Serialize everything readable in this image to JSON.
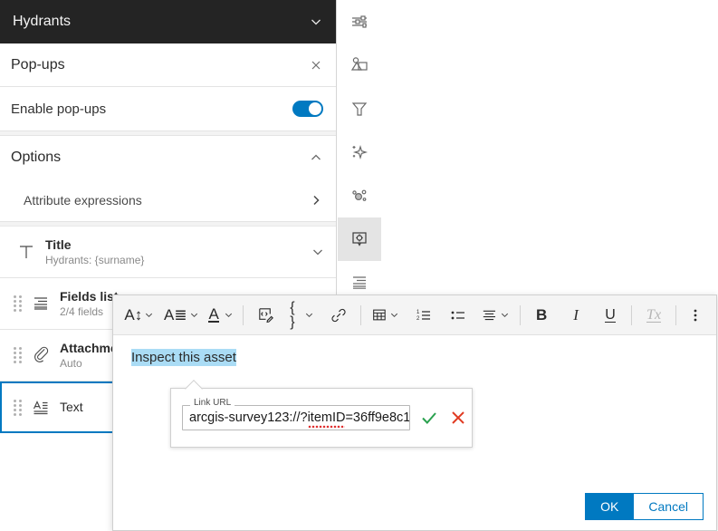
{
  "layer_panel": {
    "header": {
      "title": "Hydrants",
      "chevron_icon": "chevron-down-icon"
    },
    "popups": {
      "title": "Pop-ups",
      "close_icon": "close-icon"
    },
    "enable": {
      "label": "Enable pop-ups",
      "state": "on"
    },
    "options": {
      "label": "Options",
      "chevron_icon": "chevron-up-icon"
    },
    "attribute_expressions": {
      "label": "Attribute expressions",
      "chevron_icon": "chevron-right-icon"
    },
    "items": [
      {
        "name": "title-item",
        "icon": "text-title-icon",
        "title": "Title",
        "subtitle": "Hydrants: {surname}",
        "trailing_icon": "chevron-down-icon",
        "selected": false,
        "draggable": false
      },
      {
        "name": "fields-list-item",
        "icon": "fields-list-icon",
        "title": "Fields list",
        "subtitle": "2/4 fields",
        "selected": false,
        "draggable": true
      },
      {
        "name": "attachments-item",
        "icon": "paperclip-icon",
        "title": "Attachments",
        "subtitle": "Auto",
        "selected": false,
        "draggable": true
      },
      {
        "name": "text-item",
        "icon": "text-element-icon",
        "title": "Text",
        "subtitle": "",
        "selected": true,
        "draggable": true
      }
    ]
  },
  "icon_rail": {
    "items": [
      {
        "name": "properties-icon",
        "label": "Properties",
        "active": false
      },
      {
        "name": "symbology-image-icon",
        "label": "Symbology",
        "active": false
      },
      {
        "name": "filter-icon",
        "label": "Filter",
        "active": false
      },
      {
        "name": "effects-sparkle-icon",
        "label": "Effects",
        "active": false
      },
      {
        "name": "clustering-icon",
        "label": "Aggregation",
        "active": false
      },
      {
        "name": "popup-config-icon",
        "label": "Pop-ups",
        "active": true
      },
      {
        "name": "fields-icon",
        "label": "Fields",
        "active": false
      }
    ]
  },
  "editor": {
    "toolbar": [
      {
        "name": "font-size-button",
        "glyph": "A↕",
        "caret": true,
        "disabled": false
      },
      {
        "name": "text-style-button",
        "glyph": "A≣",
        "caret": true,
        "disabled": false
      },
      {
        "name": "font-color-button",
        "glyph": "A",
        "caret": true,
        "disabled": false
      },
      {
        "name": "source-code-button",
        "glyph": "code-edit-icon",
        "caret": false,
        "disabled": false
      },
      {
        "name": "expression-button",
        "glyph": "{ }",
        "caret": true,
        "disabled": false
      },
      {
        "name": "link-button",
        "glyph": "link-icon",
        "caret": false,
        "disabled": false
      },
      {
        "name": "table-button",
        "glyph": "table-icon",
        "caret": true,
        "disabled": false
      },
      {
        "name": "ordered-list-button",
        "glyph": "ordered-list-icon",
        "caret": false,
        "disabled": false
      },
      {
        "name": "unordered-list-button",
        "glyph": "bullet-list-icon",
        "caret": false,
        "disabled": false
      },
      {
        "name": "align-button",
        "glyph": "align-icon",
        "caret": true,
        "disabled": false
      },
      {
        "name": "bold-button",
        "glyph": "B",
        "caret": false,
        "disabled": false
      },
      {
        "name": "italic-button",
        "glyph": "I",
        "caret": false,
        "disabled": false
      },
      {
        "name": "underline-button",
        "glyph": "U",
        "caret": false,
        "disabled": false
      },
      {
        "name": "clear-format-button",
        "glyph": "Tx",
        "caret": false,
        "disabled": true
      },
      {
        "name": "more-options-button",
        "glyph": "kebab-icon",
        "caret": false,
        "disabled": false
      }
    ],
    "content": {
      "selected_text": "Inspect this asset"
    },
    "footer": {
      "ok_label": "OK",
      "cancel_label": "Cancel"
    }
  },
  "link_popover": {
    "field_label": "Link URL",
    "url_value": "arcgis-survey123://?itemID=36ff9e8c1",
    "url_prefix": "arcgis-survey123://?",
    "url_misspelled": "itemID",
    "url_suffix": "=36ff9e8c1",
    "confirm_icon": "check-icon",
    "cancel_icon": "x-icon"
  },
  "colors": {
    "accent": "#0079c1",
    "header_bg": "#242424",
    "selection": "#aadcf5",
    "confirm_green": "#2aa14f",
    "cancel_red": "#e03a21"
  }
}
